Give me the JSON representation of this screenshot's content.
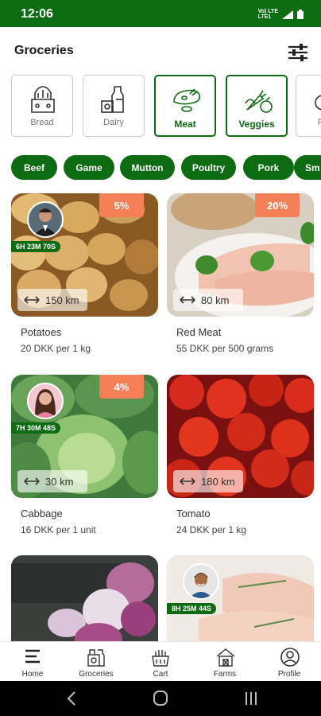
{
  "status": {
    "time": "12:06",
    "network_top": "Vo) LTE",
    "network_bottom": "LTE1"
  },
  "header": {
    "title": "Groceries"
  },
  "categories": [
    {
      "label": "Bread",
      "icon": "bread-icon",
      "active": false
    },
    {
      "label": "Dairy",
      "icon": "dairy-icon",
      "active": false
    },
    {
      "label": "Meat",
      "icon": "meat-icon",
      "active": true
    },
    {
      "label": "Veggies",
      "icon": "veggies-icon",
      "active": true
    },
    {
      "label": "F",
      "icon": "fruit-icon",
      "active": false
    }
  ],
  "subcategories": [
    "Beef",
    "Game",
    "Mutton",
    "Poultry",
    "Pork",
    "Sm"
  ],
  "products": [
    {
      "name": "Potatoes",
      "price": "20 DKK per 1 kg",
      "discount": "5%",
      "distance": "150 km",
      "timer": "6H 23M 70S",
      "image": "potatoes"
    },
    {
      "name": "Red Meat",
      "price": "55 DKK per 500 grams",
      "discount": "20%",
      "distance": "80 km",
      "image": "meat"
    },
    {
      "name": "Cabbage",
      "price": "16 DKK per 1 unit",
      "discount": "4%",
      "distance": "30 km",
      "timer": "7H 30M 48S",
      "image": "cabbage"
    },
    {
      "name": "Tomato",
      "price": "24 DKK per 1 kg",
      "distance": "180 km",
      "image": "tomato"
    },
    {
      "name": "",
      "price": "",
      "image": "turnips"
    },
    {
      "name": "",
      "price": "",
      "timer": "8H 25M 44S",
      "image": "fish"
    }
  ],
  "nav": [
    {
      "label": "Home",
      "icon": "home-menu-icon"
    },
    {
      "label": "Groceries",
      "icon": "groceries-icon"
    },
    {
      "label": "Cart",
      "icon": "cart-icon"
    },
    {
      "label": "Farms",
      "icon": "farm-icon"
    },
    {
      "label": "Profile",
      "icon": "profile-icon"
    }
  ],
  "colors": {
    "brand": "#0d6b12",
    "discount": "#f48058"
  }
}
